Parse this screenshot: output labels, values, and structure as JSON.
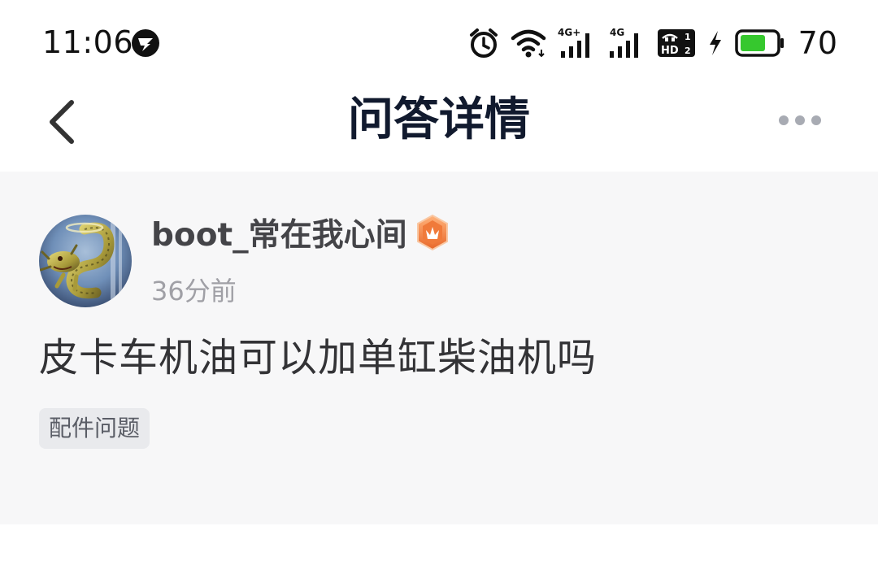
{
  "status_bar": {
    "time": "11:06",
    "battery_level": "70",
    "network_1_label": "4G+",
    "network_2_label": "4G",
    "hd_label": "HD",
    "sim_1": "1",
    "sim_2": "2"
  },
  "nav": {
    "title": "问答详情"
  },
  "question": {
    "username": "boot_常在我心间",
    "timestamp": "36分前",
    "text": "皮卡车机油可以加单缸柴油机吗",
    "tag": "配件问题"
  },
  "colors": {
    "title": "#111a2e",
    "card_background": "#f7f7f8",
    "badge_orange": "#f07a3a",
    "battery_green": "#36c82e"
  }
}
